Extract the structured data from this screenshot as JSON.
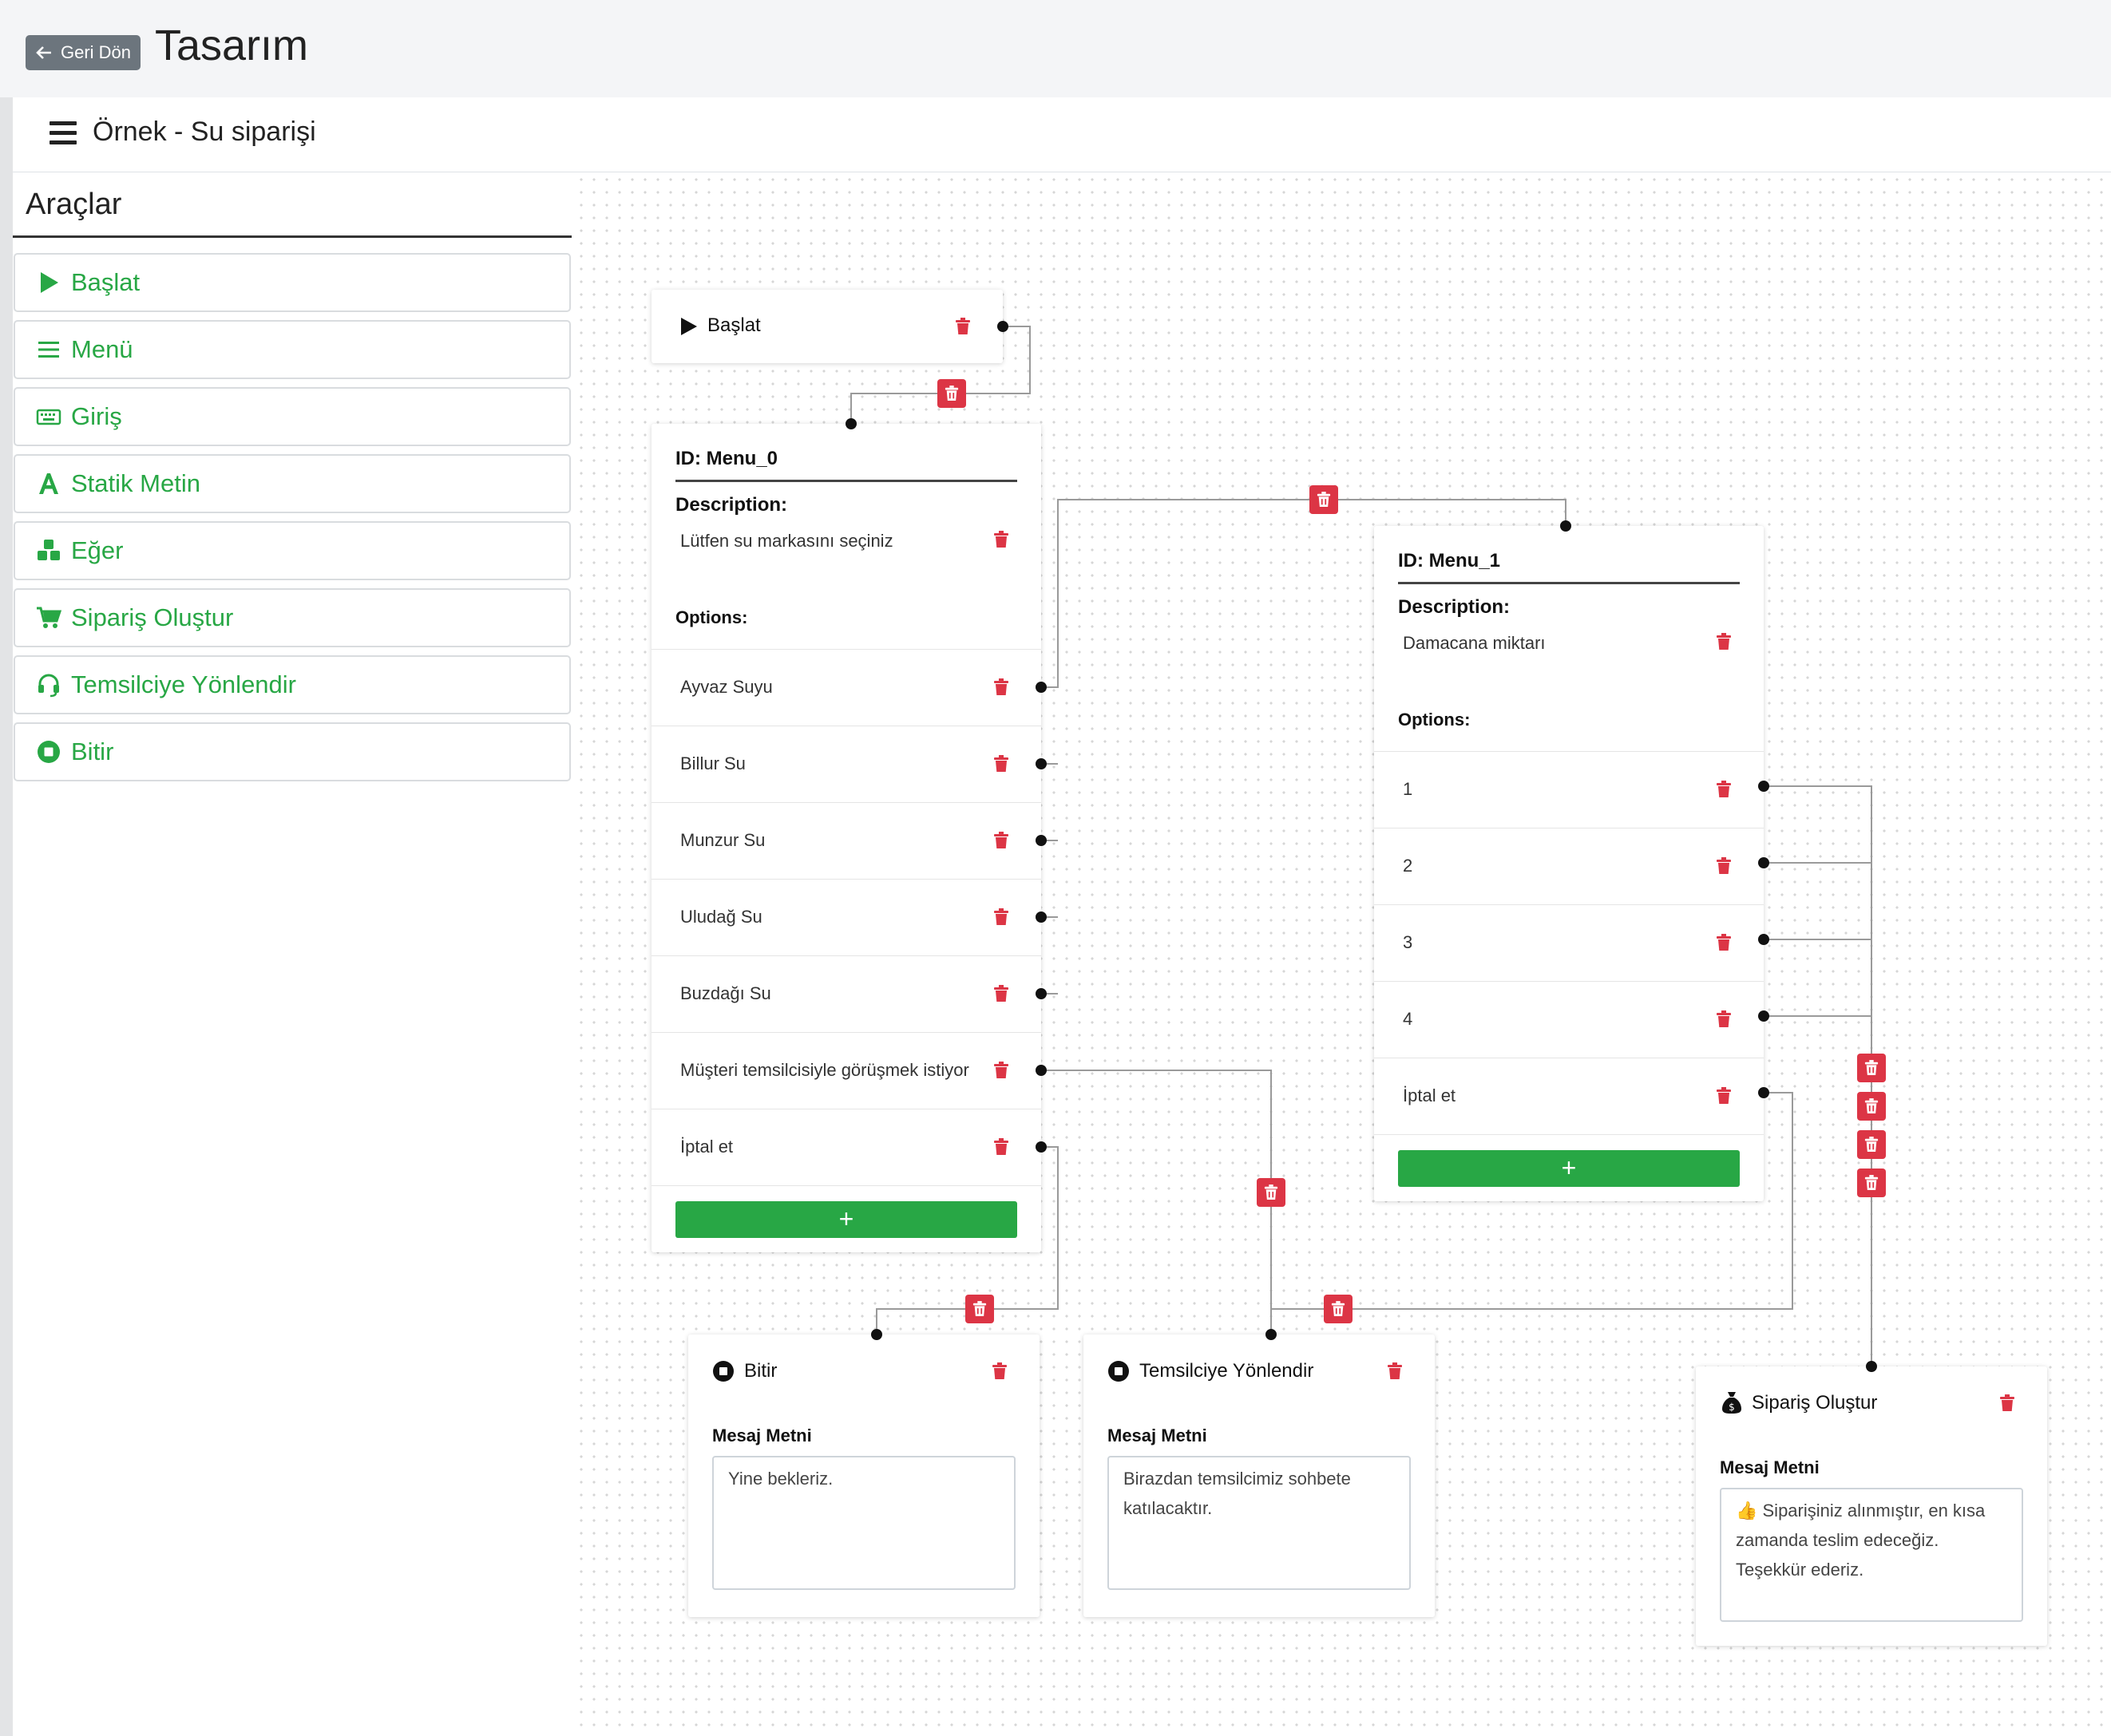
{
  "topbar": {
    "back_label": "Geri Dön",
    "title": "Tasarım"
  },
  "header": {
    "workflow_name": "Örnek - Su siparişi"
  },
  "sidebar": {
    "title": "Araçlar",
    "tools": [
      {
        "label": "Başlat",
        "icon": "play-icon"
      },
      {
        "label": "Menü",
        "icon": "menu-lines-icon"
      },
      {
        "label": "Giriş",
        "icon": "keyboard-icon"
      },
      {
        "label": "Statik Metin",
        "icon": "letter-a-icon"
      },
      {
        "label": "Eğer",
        "icon": "cubes-icon"
      },
      {
        "label": "Sipariş Oluştur",
        "icon": "cart-icon"
      },
      {
        "label": "Temsilciye Yönlendir",
        "icon": "headset-icon"
      },
      {
        "label": "Bitir",
        "icon": "stop-circle-icon"
      }
    ]
  },
  "colors": {
    "accent": "#28a745",
    "danger": "#dc3545",
    "secondary": "#6c757d"
  },
  "nodes": {
    "start": {
      "label": "Başlat"
    },
    "menu0": {
      "id_label": "ID: Menu_0",
      "description_label": "Description:",
      "description": "Lütfen su markasını seçiniz",
      "options_label": "Options:",
      "options": [
        "Ayvaz Suyu",
        "Billur Su",
        "Munzur Su",
        "Uludağ Su",
        "Buzdağı Su",
        "Müşteri temsilcisiyle görüşmek istiyor",
        "İptal et"
      ],
      "add_label": "+"
    },
    "menu1": {
      "id_label": "ID: Menu_1",
      "description_label": "Description:",
      "description": "Damacana miktarı",
      "options_label": "Options:",
      "options": [
        "1",
        "2",
        "3",
        "4",
        "İptal et"
      ],
      "add_label": "+"
    },
    "end": {
      "title": "Bitir",
      "message_label": "Mesaj Metni",
      "message": "Yine bekleriz."
    },
    "agent": {
      "title": "Temsilciye Yönlendir",
      "message_label": "Mesaj Metni",
      "message": "Birazdan temsilcimiz sohbete katılacaktır."
    },
    "order": {
      "title": "Sipariş Oluştur",
      "message_label": "Mesaj Metni",
      "message": "👍 Siparişiniz alınmıştır, en kısa zamanda teslim edeceğiz. Teşekkür ederiz."
    }
  }
}
